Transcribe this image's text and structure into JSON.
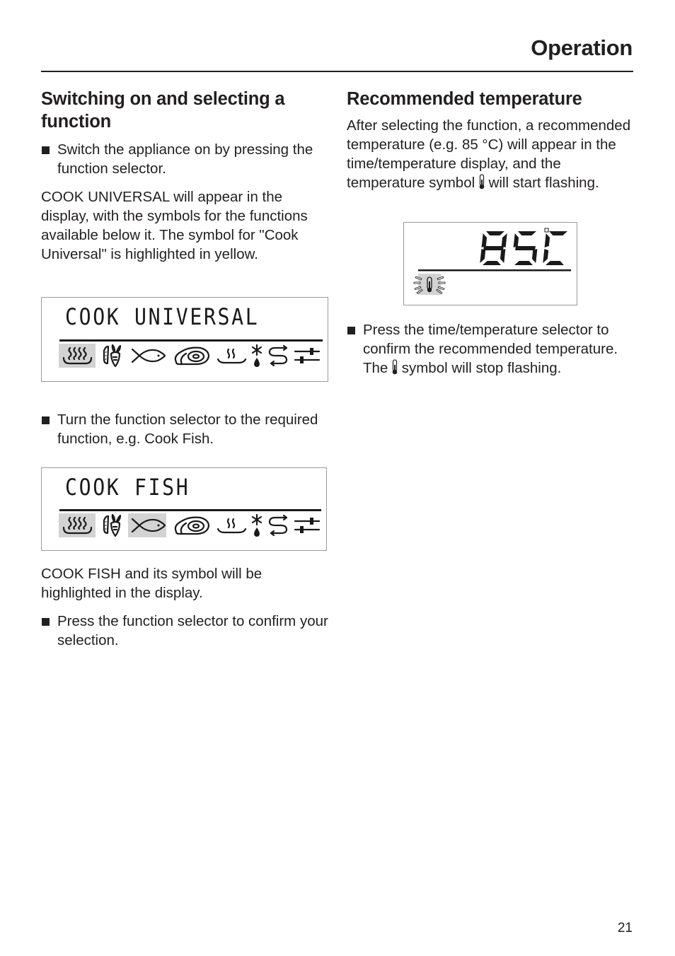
{
  "header": {
    "title": "Operation"
  },
  "left": {
    "heading": "Switching on and selecting a function",
    "step1": "Switch the appliance on by pressing the function selector.",
    "para1": "COOK UNIVERSAL will appear in the display, with the symbols for the functions available below it. The symbol for \"Cook Universal\" is highlighted in yellow.",
    "display1": {
      "text": "COOK UNIVERSAL",
      "highlighted": [
        "cook-universal"
      ]
    },
    "step2": "Turn the function selector to the required function, e.g. Cook Fish.",
    "display2": {
      "text": "COOK FISH",
      "highlighted": [
        "cook-universal",
        "cook-fish"
      ]
    },
    "para2": "COOK FISH and its symbol will be highlighted in the display.",
    "step3": "Press the function selector to confirm your selection."
  },
  "function_icons": [
    {
      "id": "cook-universal",
      "icon": "steam-tray-icon"
    },
    {
      "id": "cook-vegetables",
      "icon": "vegetables-icon"
    },
    {
      "id": "cook-fish",
      "icon": "fish-icon"
    },
    {
      "id": "cook-meat",
      "icon": "meat-icon"
    },
    {
      "id": "reheat",
      "icon": "reheat-icon"
    },
    {
      "id": "defrost",
      "icon": "defrost-icon"
    },
    {
      "id": "menu-cooking",
      "icon": "menu-cooking-icon"
    },
    {
      "id": "settings",
      "icon": "settings-icon"
    }
  ],
  "right": {
    "heading": "Recommended temperature",
    "para1_a": "After selecting the function, a recommended temperature (e.g. 85 °C) will appear in the time/temperature display, and the temperature symbol",
    "para1_b": "will start flashing.",
    "display": {
      "digits": "85",
      "unit": "C",
      "degree": "°",
      "symbol_state": "flashing"
    },
    "step1_a": "Press the time/temperature selector to confirm the recommended temperature. The",
    "step1_b": "symbol will stop flashing."
  },
  "footer": {
    "page_number": "21"
  }
}
